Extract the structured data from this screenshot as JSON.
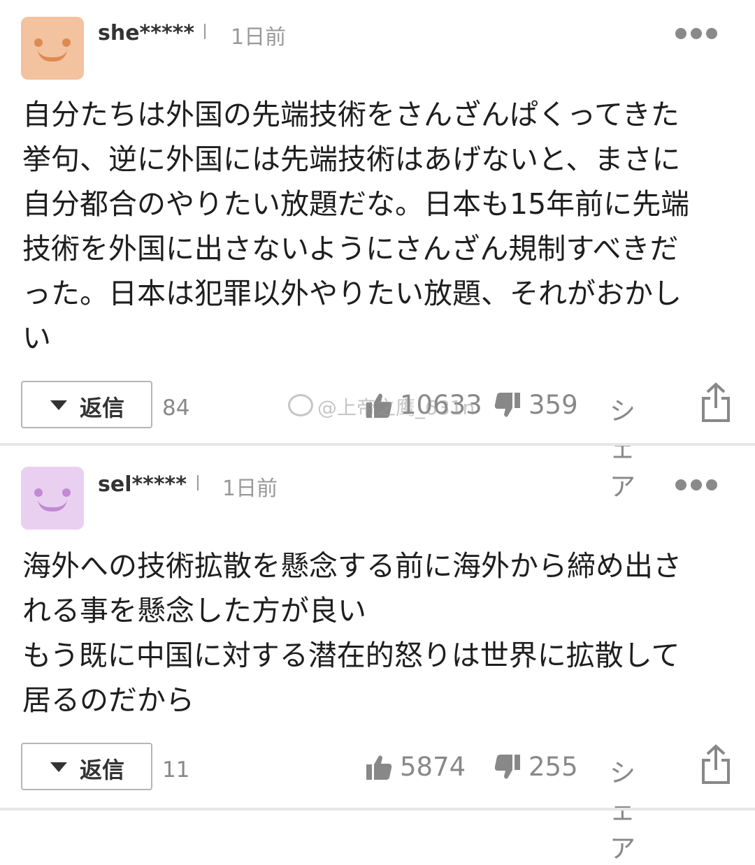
{
  "comments": [
    {
      "user": "she*****",
      "time": "1日前",
      "avatar_color": "#f3c29f",
      "body": "自分たちは外国の先端技術をさんざんぱくってきた\n挙句、逆に外国には先端技術はあげないと、まさに\n自分都合のやりたい放題だな。日本も15年前に先端\n技術を外国に出さないようにさんざん規制すべきだ\nった。日本は犯罪以外やりたい放題、それがおかし\nい",
      "reply_label": "返信",
      "reply_count": "84",
      "likes": "10633",
      "dislikes": "359",
      "share_label": "シェア"
    },
    {
      "user": "sel*****",
      "time": "1日前",
      "avatar_color": "#ead0f0",
      "body": "海外への技術拡散を懸念する前に海外から締め出さ\nれる事を懸念した方が良い\nもう既に中国に対する潜在的怒りは世界に拡散して\n居るのだから",
      "reply_label": "返信",
      "reply_count": "11",
      "likes": "5874",
      "dislikes": "255",
      "share_label": "シェア"
    }
  ],
  "icons": {
    "like": "thumbs-up-icon",
    "dislike": "thumbs-down-icon",
    "share": "share-icon",
    "more": "more-options-icon",
    "reply": "caret-down-icon"
  },
  "watermark": "@上帝之鹰_631n"
}
